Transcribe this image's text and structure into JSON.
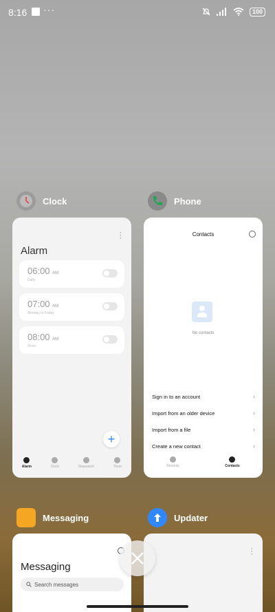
{
  "status_bar": {
    "time": "8:16",
    "dots": "···",
    "battery": "100",
    "icons": [
      "notification-square-icon",
      "mute-icon",
      "signal-icon",
      "wifi-icon",
      "battery-icon"
    ]
  },
  "apps": [
    {
      "name": "Clock",
      "icon": "clock-icon",
      "card": {
        "title": "Alarm",
        "alarms": [
          {
            "time": "06:00",
            "ampm": "AM",
            "sub": "Daily"
          },
          {
            "time": "07:00",
            "ampm": "AM",
            "sub": "Monday to Friday"
          },
          {
            "time": "08:00",
            "ampm": "AM",
            "sub": "Once"
          }
        ],
        "nav": [
          "Alarm",
          "Clock",
          "Stopwatch",
          "Timer"
        ]
      }
    },
    {
      "name": "Phone",
      "icon": "phone-icon",
      "card": {
        "title": "Contacts",
        "empty_text": "No contacts",
        "actions": [
          "Sign in to an account",
          "Import from an older device",
          "Import from a file",
          "Create a new contact"
        ],
        "nav": [
          "Recents",
          "Contacts"
        ]
      }
    },
    {
      "name": "Messaging",
      "icon": "messaging-icon",
      "card": {
        "title": "Messaging",
        "search_placeholder": "Search messages"
      }
    },
    {
      "name": "Updater",
      "icon": "updater-icon",
      "card": {}
    }
  ],
  "colors": {
    "accent": "#2f88ff",
    "clock_icon_bg": "#9b9b9b",
    "phone_icon_green": "#1fa84f",
    "messaging_icon": "#f5a623",
    "updater_icon": "#2f88ff"
  }
}
